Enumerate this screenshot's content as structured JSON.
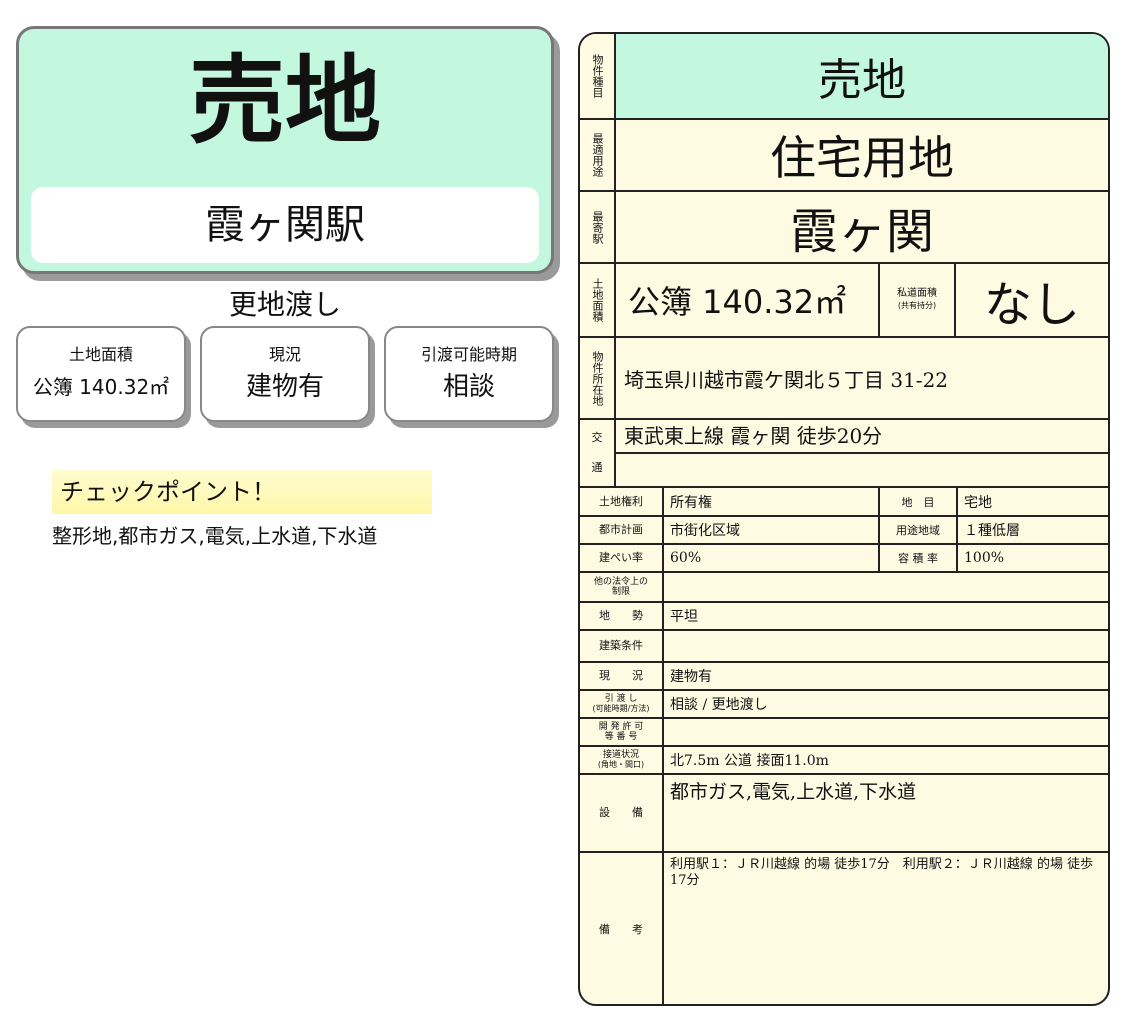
{
  "summary": {
    "title": "売地",
    "station": "霞ヶ関駅",
    "handover_note": "更地渡し",
    "cards": {
      "area": {
        "label": "土地面積",
        "value": "公簿 140.32㎡"
      },
      "status": {
        "label": "現況",
        "value": "建物有"
      },
      "handover": {
        "label": "引渡可能時期",
        "value": "相談"
      }
    },
    "checkpoint": {
      "heading": "チェックポイント！",
      "text": "整形地,都市ガス,電気,上水道,下水道"
    }
  },
  "sheet": {
    "type": {
      "label": "物件種目",
      "value": "売地"
    },
    "use": {
      "label": "最適用途",
      "value": "住宅用地"
    },
    "station": {
      "label": "最寄駅",
      "value": "霞ヶ関"
    },
    "area": {
      "label": "土地面積",
      "value": "公簿 140.32㎡",
      "private_road_label": "私道面積",
      "private_road_sub": "(共有持分)",
      "private_road_value": "なし"
    },
    "address": {
      "label": "物件所在地",
      "value": "埼玉県川越市霞ケ関北５丁目 31-22"
    },
    "access": {
      "label_1": "交",
      "label_2": "通",
      "line_1": "東武東上線 霞ヶ関 徒歩20分",
      "line_2": ""
    },
    "details": {
      "rights": {
        "label": "土地権利",
        "value": "所有権"
      },
      "land_category": {
        "label": "地　目",
        "value": "宅地"
      },
      "city_plan": {
        "label": "都市計画",
        "value": "市街化区域"
      },
      "zoning": {
        "label": "用途地域",
        "value": "１種低層"
      },
      "coverage": {
        "label": "建ぺい率",
        "value": "60%"
      },
      "floor_ratio": {
        "label": "容 積 率",
        "value": "100%"
      },
      "other_limits": {
        "label": "他の法令上の制限",
        "value": ""
      },
      "terrain": {
        "label": "地　　勢",
        "value": "平坦"
      },
      "building_conditions": {
        "label": "建築条件",
        "value": ""
      },
      "current": {
        "label": "現　　況",
        "value": "建物有"
      },
      "handover": {
        "label_1": "引 渡 し",
        "label_2": "(可能時期/方法)",
        "value": "相談 / 更地渡し"
      },
      "dev_permit": {
        "label_1": "開 発 許 可",
        "label_2": "等 番 号",
        "value": ""
      },
      "road": {
        "label_1": "接道状況",
        "label_2": "(角地・間口)",
        "value": "北7.5m 公道 接面11.0m"
      },
      "facilities": {
        "label": "設　　備",
        "value": "都市ガス,電気,上水道,下水道"
      },
      "remarks": {
        "label": "備　　考",
        "value": "利用駅１：ＪＲ川越線 的場 徒歩17分　利用駅２：ＪＲ川越線 的場 徒歩17分"
      }
    }
  }
}
